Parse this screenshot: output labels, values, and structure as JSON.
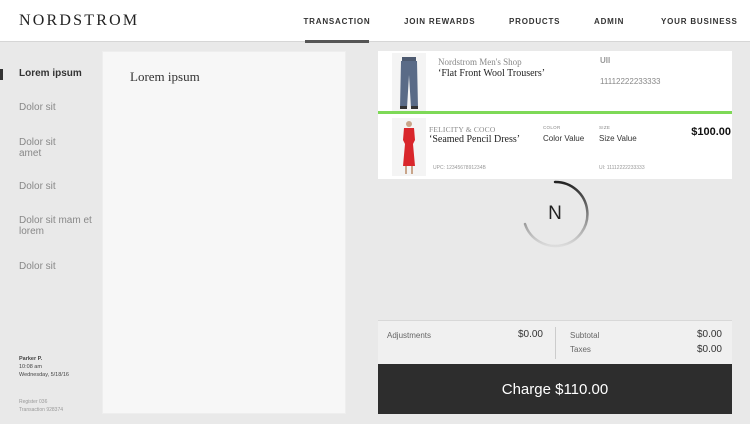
{
  "header": {
    "logo": "NORDSTROM",
    "nav": [
      {
        "label": "TRANSACTION",
        "active": true
      },
      {
        "label": "JOIN REWARDS"
      },
      {
        "label": "PRODUCTS"
      },
      {
        "label": "ADMIN"
      },
      {
        "label": "YOUR BUSINESS"
      }
    ]
  },
  "sidebar": {
    "items": [
      {
        "label": "Lorem ipsum",
        "active": true
      },
      {
        "label": "Dolor sit"
      },
      {
        "label": "Dolor sit amet"
      },
      {
        "label": "Dolor sit"
      },
      {
        "label": "Dolor sit mam et lorem"
      },
      {
        "label": "Dolor sit"
      }
    ],
    "user": {
      "name": "Parker P.",
      "time": "10:08 am",
      "date": "Wednesday, 5/18/16"
    },
    "register": "Register 036",
    "transaction": "Transaction 928374"
  },
  "main": {
    "title": "Lorem ipsum"
  },
  "cart": {
    "item1": {
      "brand": "Nordstrom Men's Shop",
      "name": "‘Flat Front Wool Trousers’",
      "uii_label": "UII",
      "uii_value": "11112222233333"
    },
    "item2": {
      "brand": "FELICITY & COCO",
      "name": "‘Seamed Pencil Dress’",
      "color_label": "COLOR",
      "color_value": "Color Value",
      "size_label": "SIZE",
      "size_value": "Size Value",
      "price": "$100.00",
      "upc": "UPC: 1234567891234B",
      "ui": "UI: 11112222233333"
    }
  },
  "spinner": {
    "letter": "N"
  },
  "totals": {
    "adjustments_label": "Adjustments",
    "adjustments_value": "$0.00",
    "subtotal_label": "Subtotal",
    "subtotal_value": "$0.00",
    "taxes_label": "Taxes",
    "taxes_value": "$0.00"
  },
  "charge_label": "Charge $110.00",
  "colors": {
    "accent_green": "#7ed957",
    "charge_bg": "#2d2d2d",
    "dress_red": "#d9262b",
    "trouser_blue": "#5a6b87"
  }
}
